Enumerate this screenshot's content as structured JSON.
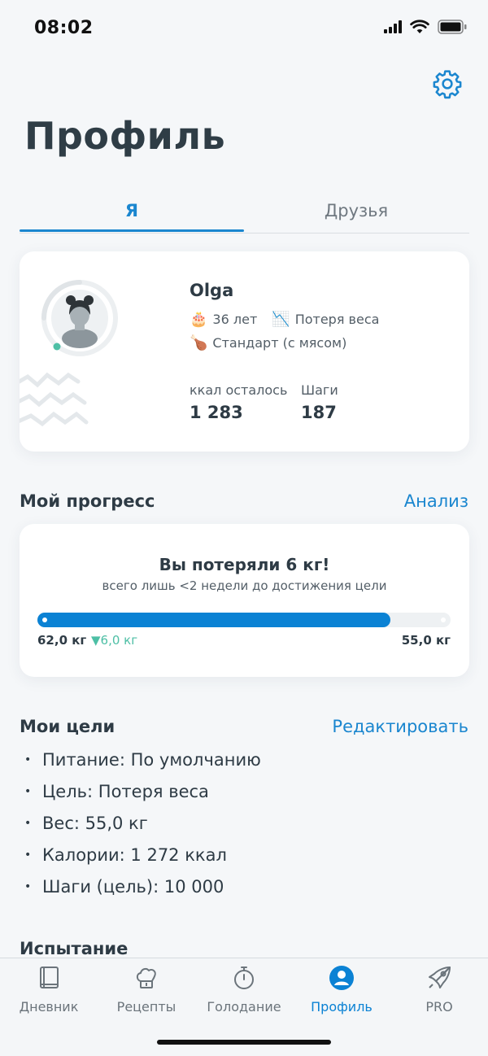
{
  "status_bar": {
    "time": "08:02"
  },
  "header": {
    "title": "Профиль",
    "settings_icon": "gear-icon"
  },
  "tabs": [
    {
      "label": "Я",
      "active": true
    },
    {
      "label": "Друзья",
      "active": false
    }
  ],
  "profile": {
    "name": "Olga",
    "age_icon": "🎂",
    "age": "36 лет",
    "goal_icon": "📉",
    "goal": "Потеря веса",
    "diet_icon": "🍗",
    "diet": "Стандарт (с мясом)",
    "kcal_label": "ккал осталось",
    "kcal_value": "1 283",
    "steps_label": "Шаги",
    "steps_value": "187"
  },
  "progress": {
    "section_title": "Мой прогресс",
    "link": "Анализ",
    "headline": "Вы потеряли 6 кг!",
    "subtext": "всего лишь <2 недели до достижения цели",
    "start": "62,0 кг",
    "delta": "▼6,0 кг",
    "end": "55,0 кг",
    "bar_fraction": 0.855,
    "bar_color": "#0B82D4"
  },
  "goals": {
    "section_title": "Мои цели",
    "link": "Редактировать",
    "items": [
      "Питание: По умолчанию",
      "Цель: Потеря веса",
      "Вес: 55,0 кг",
      "Калории: 1 272 ккал",
      "Шаги (цель): 10 000"
    ]
  },
  "challenge": {
    "section_title": "Испытание"
  },
  "nav": [
    {
      "label": "Дневник",
      "icon": "diary-book-icon",
      "active": false
    },
    {
      "label": "Рецепты",
      "icon": "chef-hat-icon",
      "active": false
    },
    {
      "label": "Голодание",
      "icon": "stopwatch-icon",
      "active": false
    },
    {
      "label": "Профиль",
      "icon": "profile-icon",
      "active": true
    },
    {
      "label": "PRO",
      "icon": "rocket-icon",
      "active": false
    }
  ],
  "colors": {
    "accent": "#1A86CF",
    "success": "#4DBFA5",
    "background": "#F5F7F9"
  }
}
